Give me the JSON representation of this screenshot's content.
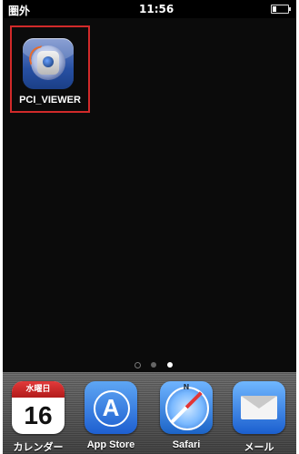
{
  "status_bar": {
    "carrier": "圏外",
    "time": "11:56"
  },
  "home": {
    "apps": [
      {
        "label": "PCI_VIEWER",
        "icon": "camera-viewer-icon",
        "highlighted": true,
        "highlight_color": "#d12a2a"
      }
    ],
    "page_indicator": {
      "pages": 2,
      "active_index": 1,
      "has_search_page": true
    }
  },
  "dock": {
    "apps": [
      {
        "label": "カレンダー",
        "icon": "calendar-icon",
        "calendar_weekday": "水曜日",
        "calendar_day": "16"
      },
      {
        "label": "App Store",
        "icon": "app-store-icon",
        "glyph": "A"
      },
      {
        "label": "Safari",
        "icon": "safari-icon",
        "compass_letter": "N"
      },
      {
        "label": "メール",
        "icon": "mail-icon"
      }
    ]
  }
}
